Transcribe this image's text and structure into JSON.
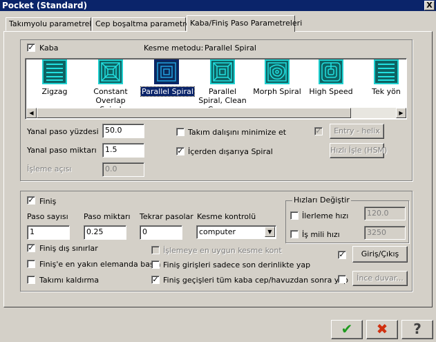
{
  "window": {
    "title": "Pocket (Standard)",
    "close_glyph": "X"
  },
  "tabs": [
    {
      "label": "Takımyolu parametreleri"
    },
    {
      "label": "Cep boşaltma parametreleri"
    },
    {
      "label": "Kaba/Finiş Paso Parametreleri"
    }
  ],
  "rough": {
    "checkbox_label": "Kaba",
    "checked": true,
    "cut_method_label": "Kesme metodu:",
    "cut_method_value": "Parallel Spiral",
    "methods": [
      {
        "label": "Zigzag",
        "icon": "zigzag-icon",
        "selected": false
      },
      {
        "label": "Constant Overlap Spiral",
        "icon": "constant-overlap-spiral-icon",
        "selected": false
      },
      {
        "label": "Parallel Spiral",
        "icon": "parallel-spiral-icon",
        "selected": true
      },
      {
        "label": "Parallel Spiral, Clean Corners",
        "icon": "parallel-spiral-clean-corners-icon",
        "selected": false
      },
      {
        "label": "Morph Spiral",
        "icon": "morph-spiral-icon",
        "selected": false
      },
      {
        "label": "High Speed",
        "icon": "high-speed-icon",
        "selected": false
      },
      {
        "label": "Tek yön",
        "icon": "one-way-icon",
        "selected": false
      }
    ],
    "stepover_percent_label": "Yanal paso yüzdesi",
    "stepover_percent_value": "50.0",
    "stepover_distance_label": "Yanal paso miktarı",
    "stepover_distance_value": "1.5",
    "angle_label": "İşleme açısı",
    "angle_value": "0.0",
    "minimize_plunge_label": "Takım dalışını minimize et",
    "minimize_plunge_checked": false,
    "spiral_inside_out_label": "İçerden dışarıya Spiral",
    "spiral_inside_out_checked": true,
    "entry_helix_label": "Entry - helix",
    "entry_helix_checked": true,
    "hsm_label": "Hızlı İşle (HSM)"
  },
  "finish": {
    "checkbox_label": "Finiş",
    "checked": true,
    "passes_label": "Paso sayısı",
    "passes_value": "1",
    "spacing_label": "Paso miktarı",
    "spacing_value": "0.25",
    "spring_label": "Tekrar pasolar",
    "spring_value": "0",
    "cutter_comp_label": "Kesme kontrolü",
    "cutter_comp_value": "computer",
    "outer_boundaries_label": "Finiş dış sınırlar",
    "outer_boundaries_checked": true,
    "closest_element_label": "Finiş'e en yakın elemanda başla",
    "closest_element_checked": false,
    "keep_tool_down_label": "Takımı kaldırma",
    "keep_tool_down_checked": false,
    "optimize_cut_label": "İşlemeye en uygun kesme kont",
    "optimize_cut_checked": false,
    "final_depth_only_label": "Finiş girişleri sadece son derinlikte yap",
    "final_depth_only_checked": false,
    "after_roughing_label": "Finiş geçişleri tüm kaba cep/havuzdan sonra yap",
    "after_roughing_checked": true,
    "lead_in_out_label": "Giriş/Çıkış",
    "lead_in_out_checked": true,
    "thin_walls_label": "İnce duvar...",
    "thin_walls_checked": false
  },
  "speeds": {
    "group_label": "Hızları Değiştir",
    "feed_label": "İlerleme hızı",
    "feed_checked": false,
    "feed_value": "120.0",
    "spindle_label": "İş mili hızı",
    "spindle_checked": false,
    "spindle_value": "3250"
  },
  "footer": {
    "ok_glyph": "✔",
    "cancel_glyph": "✖",
    "help_glyph": "?"
  },
  "colors": {
    "title_bar": "#0a246a",
    "ok": "#1f9a1f",
    "cancel": "#d03010",
    "icon_bg": "#0d6363",
    "icon_line": "#22e0e0"
  }
}
